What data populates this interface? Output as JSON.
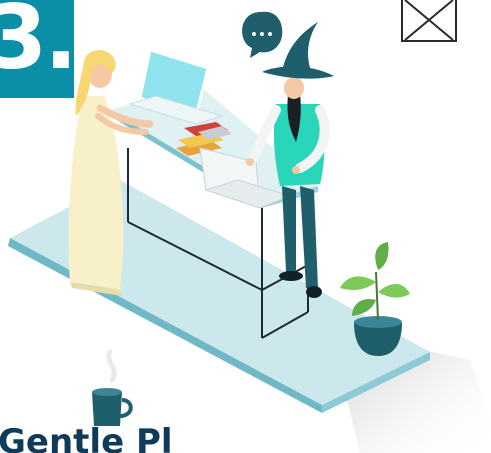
{
  "step": {
    "number": "3."
  },
  "caption": {
    "text": "Gentle Pl"
  },
  "close_button": {
    "icon": "close-x-icon"
  },
  "illustration": {
    "people": [
      "woman-with-laptop",
      "wizard-with-laptop"
    ],
    "icons": [
      "speech-bubble-icon",
      "plant-icon",
      "coffee-mug-icon",
      "books-icon",
      "laptop-icon"
    ]
  },
  "colors": {
    "teal": "#0b8fa6",
    "navy": "#0f3a5a",
    "platform": "#cde8ec",
    "mint": "#2ad6b9",
    "dark_teal": "#1e5f6b"
  }
}
